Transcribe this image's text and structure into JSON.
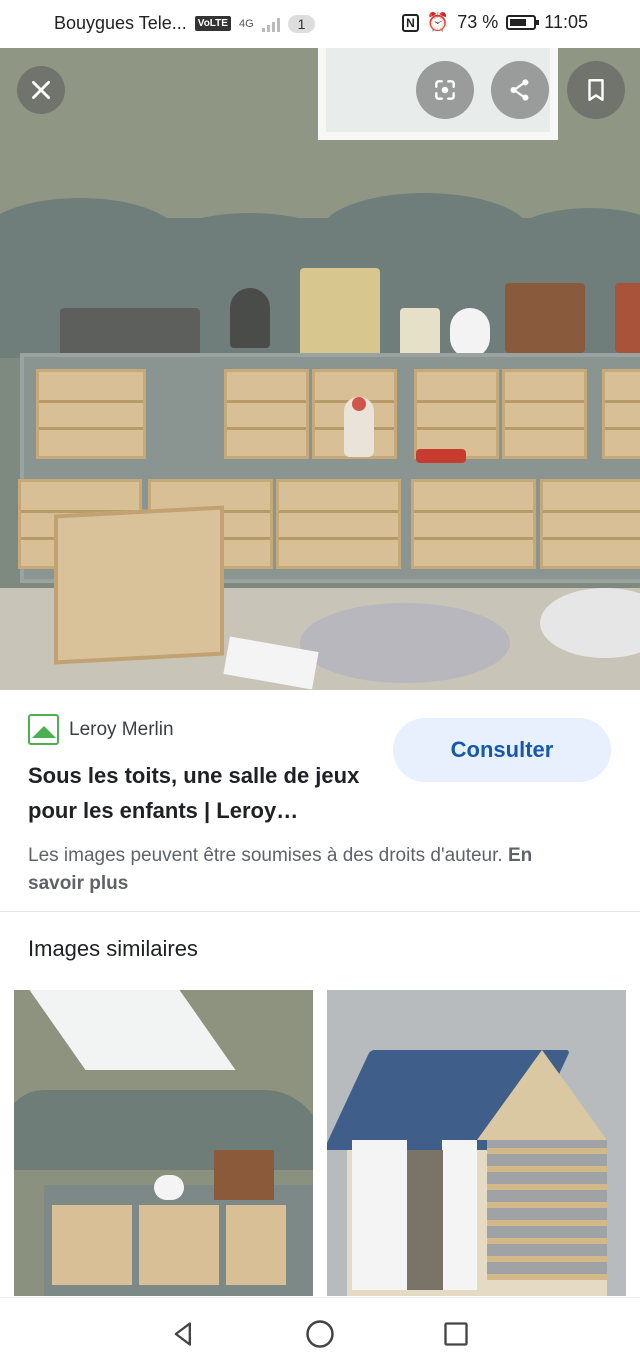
{
  "status_bar": {
    "carrier": "Bouygues Tele...",
    "volte": "VoLTE",
    "network": "4G",
    "notification_count": "1",
    "battery_percent": "73 %",
    "time": "11:05"
  },
  "viewer": {
    "close_icon": "close-icon",
    "lens_icon": "lens-icon",
    "share_icon": "share-icon",
    "bookmark_icon": "bookmark-icon"
  },
  "result": {
    "source_name": "Leroy Merlin",
    "title": "Sous les toits, une salle de jeux pour les enfants | Leroy…",
    "consult_label": "Consulter",
    "copyright_text": "Les images peuvent être soumises à des droits d'auteur.",
    "learn_more_label": "En savoir plus"
  },
  "similar": {
    "heading": "Images similaires"
  },
  "colors": {
    "accent_blue": "#1558b0",
    "button_bg": "#e8f0fe",
    "brand_green": "#4caf50"
  }
}
